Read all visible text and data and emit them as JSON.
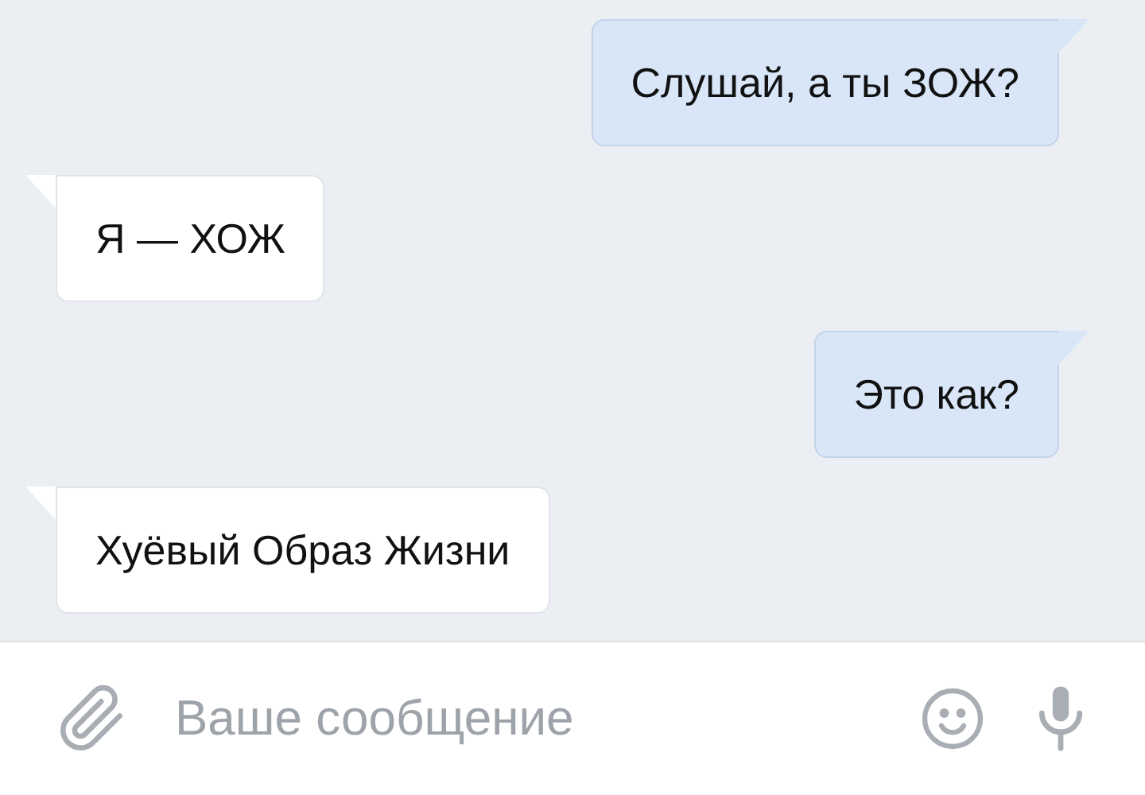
{
  "messages": [
    {
      "text": "Слушай, а ты ЗОЖ?",
      "outgoing": true
    },
    {
      "text": "Я — ХОЖ",
      "outgoing": false
    },
    {
      "text": "Это как?",
      "outgoing": true
    },
    {
      "text": "Хуёвый Образ Жизни",
      "outgoing": false
    }
  ],
  "composer": {
    "placeholder": "Ваше сообщение"
  }
}
